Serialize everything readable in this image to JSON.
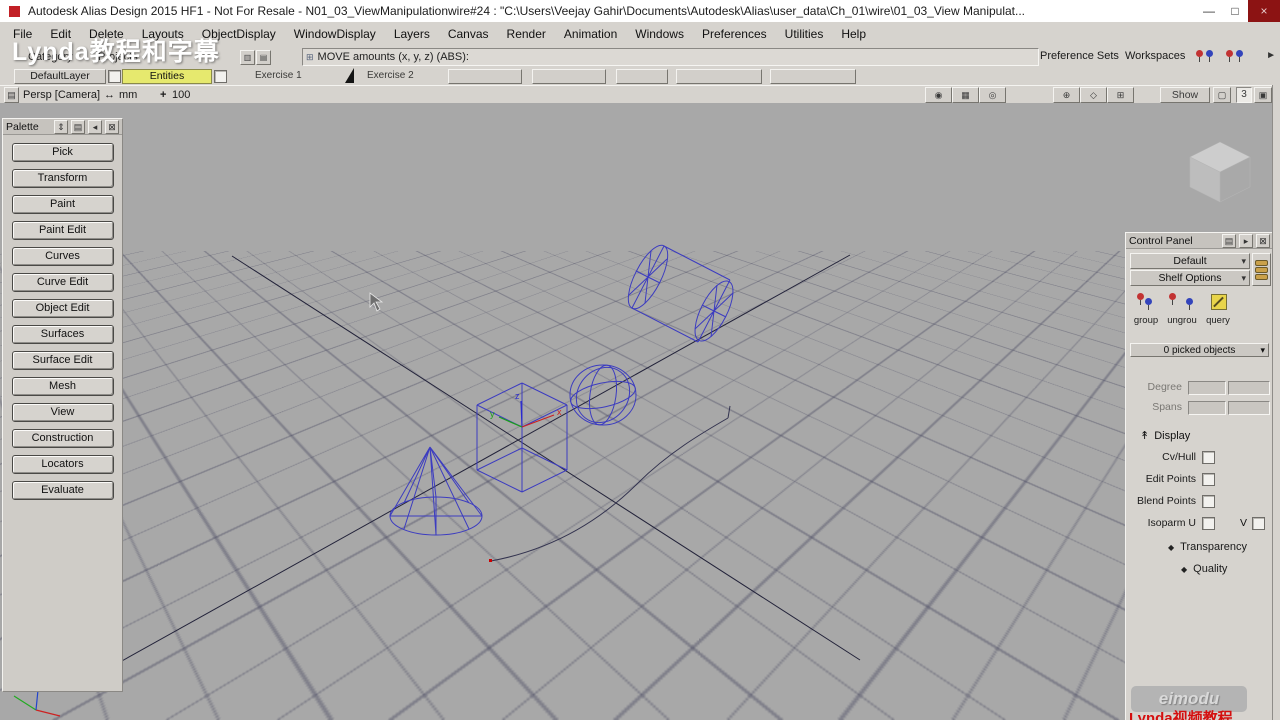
{
  "window": {
    "title": "Autodesk Alias Design 2015 HF1 - Not For Resale   - N01_03_ViewManipulationwire#24 : \"C:\\Users\\Veejay Gahir\\Documents\\Autodesk\\Alias\\user_data\\Ch_01\\wire\\01_03_View Manipulat...",
    "minimize": "—",
    "maximize": "□",
    "close": "×"
  },
  "menu": {
    "items": [
      "File",
      "Edit",
      "Delete",
      "Layouts",
      "ObjectDisplay",
      "WindowDisplay",
      "Layers",
      "Canvas",
      "Render",
      "Animation",
      "Windows",
      "Preferences",
      "Utilities",
      "Help"
    ]
  },
  "toolbar": {
    "category": "Category",
    "projects": "Projects",
    "prompt": "MOVE amounts (x, y, z) (ABS):",
    "preference_sets": "Preference Sets",
    "workspaces": "Workspaces"
  },
  "shelf": {
    "default_layer": "DefaultLayer",
    "entities": "Entities",
    "exercise1": "Exercise 1",
    "exercise2": "Exercise 2"
  },
  "view_header": {
    "camera": "Persp [Camera]",
    "units": "mm",
    "grid_value": "100",
    "show_label": "Show",
    "count": "3"
  },
  "palette": {
    "title": "Palette",
    "items": [
      "Pick",
      "Transform",
      "Paint",
      "Paint Edit",
      "Curves",
      "Curve Edit",
      "Object Edit",
      "Surfaces",
      "Surface Edit",
      "Mesh",
      "View",
      "Construction",
      "Locators",
      "Evaluate"
    ]
  },
  "control_panel": {
    "title": "Control Panel",
    "preset": "Default",
    "shelf_options": "Shelf Options",
    "tools": [
      "group",
      "ungrou",
      "query"
    ],
    "picked": "0 picked objects",
    "degree_label": "Degree",
    "spans_label": "Spans",
    "display_label": "Display",
    "rows": [
      "Cv/Hull",
      "Edit Points",
      "Blend Points",
      "Isoparm U"
    ],
    "v_label": "V",
    "transparency_label": "Transparency",
    "quality_label": "Quality"
  },
  "viewport_labels": {
    "x": "x",
    "y": "y",
    "z": "z"
  },
  "watermarks": {
    "top": "Lynda教程和字幕",
    "badge": "eimodu",
    "bottom": "Lynda视频教程"
  },
  "icons": {
    "min": "—",
    "max": "□",
    "close": "×",
    "window_menu": "▤",
    "resize": "↔",
    "move": "+",
    "look": "◉",
    "film": "▦",
    "zoom": "◎",
    "track": "⊕",
    "orbit": "◇",
    "fit": "⊞",
    "frame": "▢",
    "layout": "▣",
    "chevron_down": "▾",
    "chevron_right": "▸",
    "close_box": "⊠",
    "updown": "⇕",
    "list": "▤",
    "collapse": "◂",
    "play": "►",
    "grip": "⊞",
    "diamond": "◆",
    "tree": "↟",
    "pane": "▥"
  },
  "colors": {
    "wireframe": "#3c3cc0",
    "accent_yellow": "#e6e96e",
    "close_red": "#8c1313"
  }
}
